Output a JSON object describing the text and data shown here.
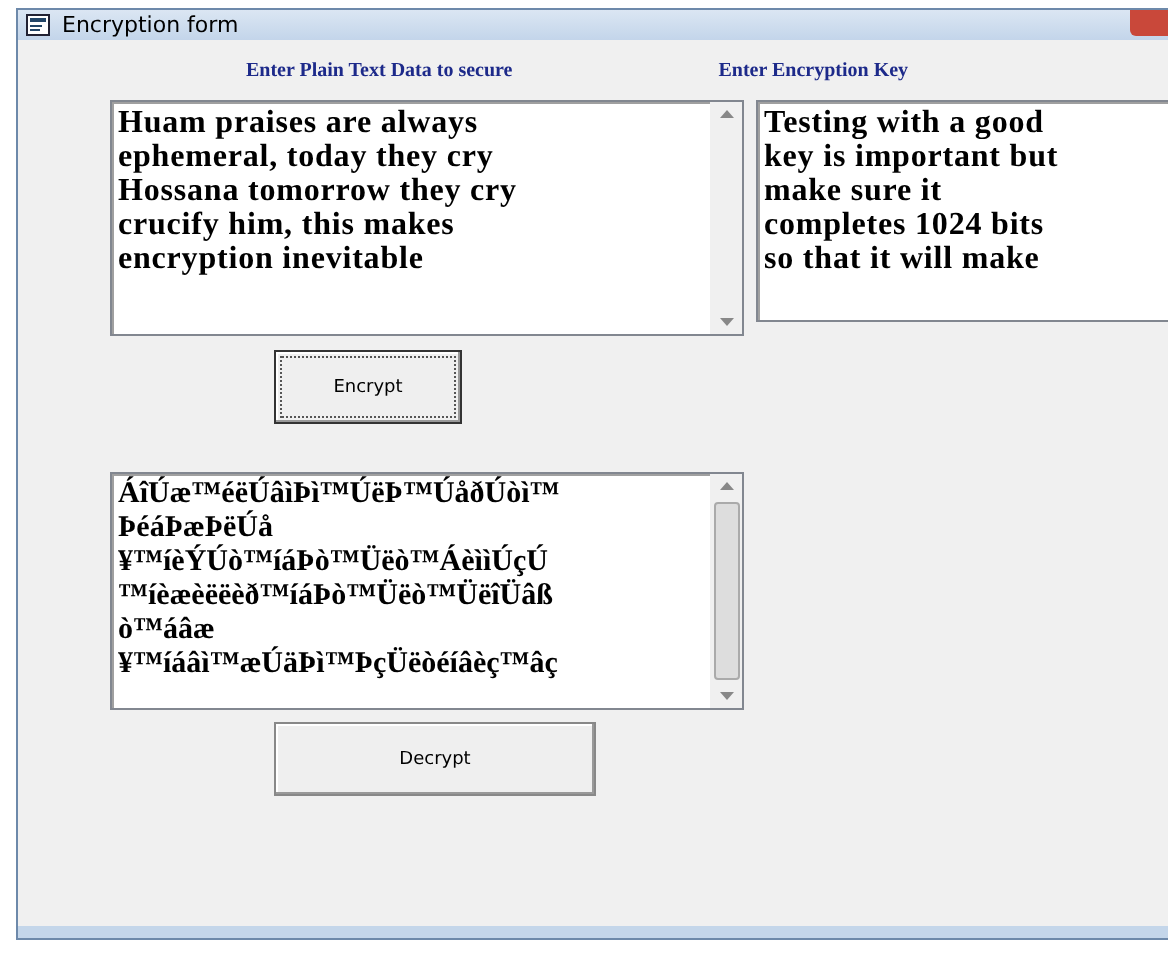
{
  "window": {
    "title": "Encryption form"
  },
  "plain_label": "Enter Plain Text Data to secure",
  "key_label": "Enter Encryption Key",
  "plain_text": "Huam praises are always\nephemeral, today they cry\nHossana tomorrow they cry\ncrucify him, this makes\nencryption inevitable",
  "key_text": "Testing with a good\nkey is important but\nmake sure it\ncompletes 1024 bits\nso that it will make",
  "encrypt_button": {
    "label": "Encrypt",
    "focused": true
  },
  "cipher_text": "ÁîÚæ™éëÚâìÞì™ÚëÞ™ÚåðÚòì™\nÞéáÞæÞëÚå\n¥™íèÝÚò™íáÞò™Üëò™ÁèììÚçÚ\n™íèæèëëèð™íáÞò™Üëò™ÜëîÜâß\nò™áâæ\n¥™íáâì™æÚäÞì™ÞçÜëòéíâèç™âç",
  "decrypt_button": {
    "label": "Decrypt",
    "focused": false
  }
}
